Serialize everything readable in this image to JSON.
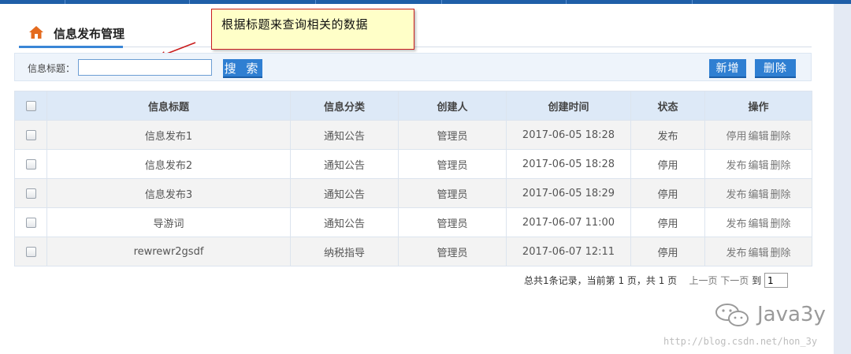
{
  "header": {
    "title": "信息发布管理",
    "icon": "home-icon"
  },
  "callout": {
    "text": "根据标题来查询相关的数据"
  },
  "search": {
    "label": "信息标题：",
    "value": "",
    "placeholder": "",
    "search_label": "搜 索",
    "add_label": "新增",
    "delete_label": "删除"
  },
  "table": {
    "columns": [
      "信息标题",
      "信息分类",
      "创建人",
      "创建时间",
      "状态",
      "操作"
    ],
    "rows": [
      {
        "title": "信息发布1",
        "category": "通知公告",
        "creator": "管理员",
        "created": "2017-06-05 18:28",
        "status": "发布",
        "actions": [
          "停用",
          "编辑",
          "删除"
        ]
      },
      {
        "title": "信息发布2",
        "category": "通知公告",
        "creator": "管理员",
        "created": "2017-06-05 18:28",
        "status": "停用",
        "actions": [
          "发布",
          "编辑",
          "删除"
        ]
      },
      {
        "title": "信息发布3",
        "category": "通知公告",
        "creator": "管理员",
        "created": "2017-06-05 18:29",
        "status": "停用",
        "actions": [
          "发布",
          "编辑",
          "删除"
        ]
      },
      {
        "title": "导游词",
        "category": "通知公告",
        "creator": "管理员",
        "created": "2017-06-07 11:00",
        "status": "停用",
        "actions": [
          "发布",
          "编辑",
          "删除"
        ]
      },
      {
        "title": "rewrewr2gsdf",
        "category": "纳税指导",
        "creator": "管理员",
        "created": "2017-06-07 12:11",
        "status": "停用",
        "actions": [
          "发布",
          "编辑",
          "删除"
        ]
      }
    ]
  },
  "pager": {
    "summary": "总共1条记录，当前第 1 页，共 1 页",
    "prev": "上一页",
    "next": "下一页",
    "goto": "到",
    "page_value": "1"
  },
  "watermark": {
    "text": "Java3y",
    "url": "http://blog.csdn.net/hon_3y"
  },
  "colors": {
    "accent": "#2f7fd2",
    "topbar": "#1f5fa8",
    "callout_bg": "#ffffc8",
    "callout_border": "#c91d1d"
  }
}
